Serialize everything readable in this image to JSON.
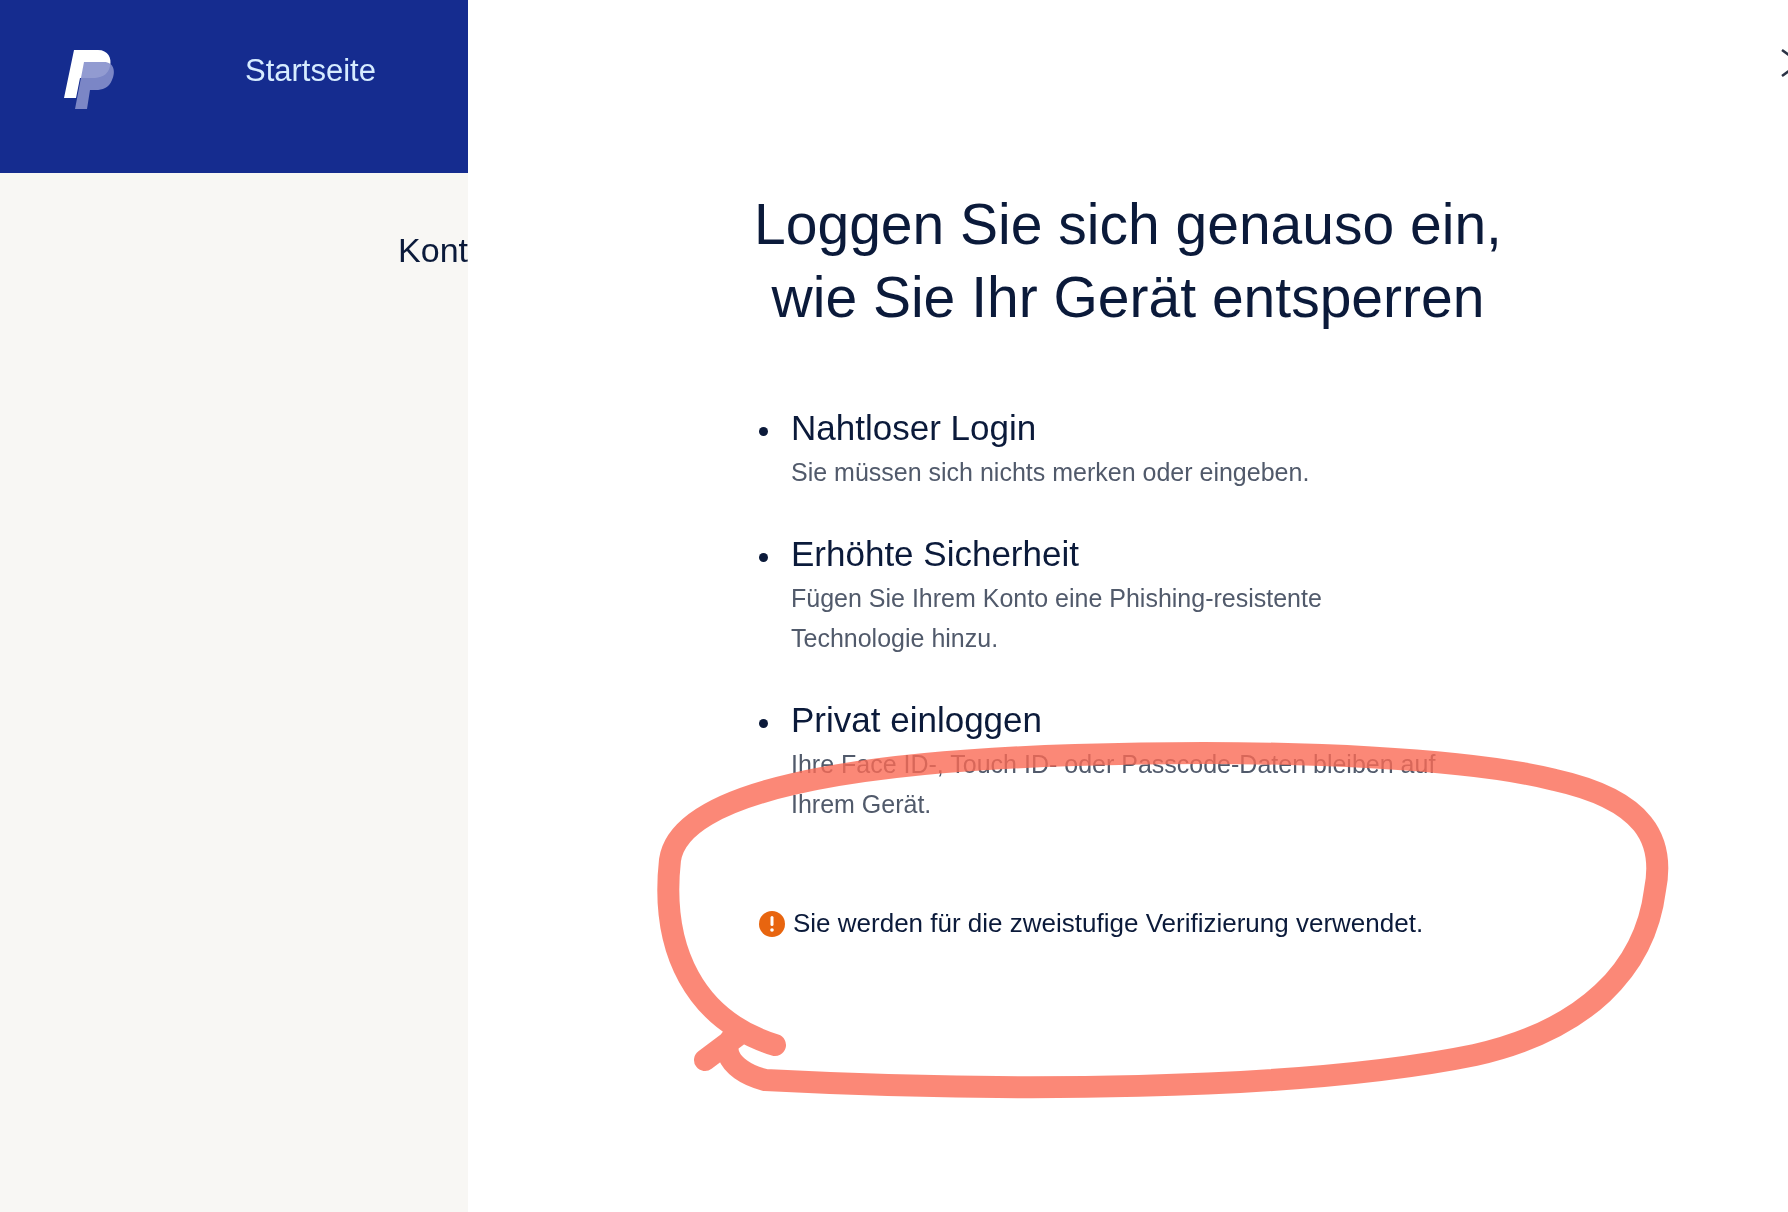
{
  "header": {
    "nav_link": "Startseite"
  },
  "sidebar": {
    "items": [
      "Kont"
    ]
  },
  "dialog": {
    "title_lines": [
      "Loggen Sie sich genauso ein,",
      "wie Sie Ihr Gerät entsperren"
    ],
    "benefits": [
      {
        "title": "Nahtloser Login",
        "text": "Sie müssen sich nichts merken oder eingeben."
      },
      {
        "title": "Erhöhte Sicherheit",
        "text": "Fügen Sie Ihrem Konto eine Phishing-resistente Technologie hinzu."
      },
      {
        "title": "Privat einloggen",
        "text": "Ihre Face ID-, Touch ID- oder Passcode-Daten bleiben auf Ihrem Gerät."
      }
    ],
    "notice": {
      "text": "Sie werden für die zweistufige Verifizierung verwendet."
    }
  }
}
